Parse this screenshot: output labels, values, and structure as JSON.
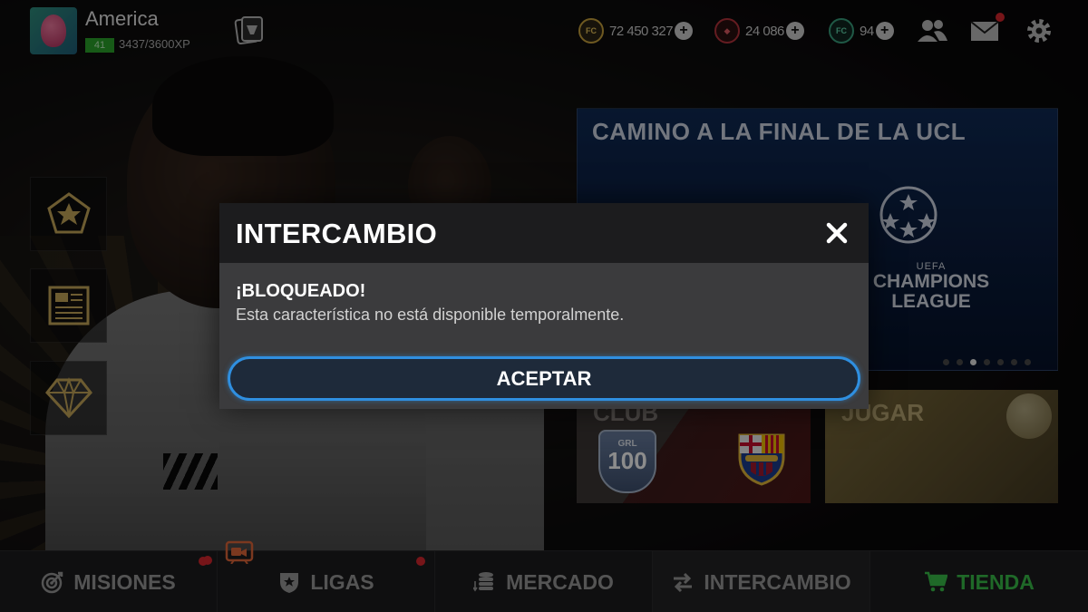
{
  "profile": {
    "name": "America",
    "level": "41",
    "xp": "3437/3600XP"
  },
  "currencies": [
    {
      "icon": "fc-coin-icon",
      "value": "72450327",
      "display": "72 450 327",
      "color": "#c8a23c"
    },
    {
      "icon": "fc-points-gem-icon",
      "value": "24086",
      "display": "24 086",
      "color": "#b7343c"
    },
    {
      "icon": "rank-token-icon",
      "value": "94",
      "display": "94",
      "color": "#3aa07f"
    }
  ],
  "banner": {
    "title": "CAMINO A LA FINAL DE LA UCL",
    "logo_small": "UEFA",
    "logo_big": "CHAMPIONS LEAGUE"
  },
  "tiles": {
    "club": {
      "title": "CLUB",
      "grl_label": "GRL",
      "grl_value": "100"
    },
    "jugar": {
      "title": "JUGAR"
    }
  },
  "nav": [
    {
      "label": "MISIONES",
      "icon": "target-icon",
      "active": false,
      "notification": true
    },
    {
      "label": "LIGAS",
      "icon": "shield-star-icon",
      "active": false,
      "notification": true
    },
    {
      "label": "MERCADO",
      "icon": "coins-stack-icon",
      "active": false,
      "notification": false
    },
    {
      "label": "INTERCAMBIO",
      "icon": "exchange-arrows-icon",
      "active": true,
      "notification": false
    },
    {
      "label": "TIENDA",
      "icon": "cart-icon",
      "active": false,
      "notification": false
    }
  ],
  "dialog": {
    "title": "INTERCAMBIO",
    "heading": "¡BLOQUEADO!",
    "message": "Esta característica no está disponible temporalmente.",
    "accept_label": "ACEPTAR"
  },
  "colors": {
    "accent_blue": "#2f8fe0",
    "shop_green": "#3ac04a",
    "notification_red": "#d9272e",
    "level_green": "#2aa52a"
  }
}
